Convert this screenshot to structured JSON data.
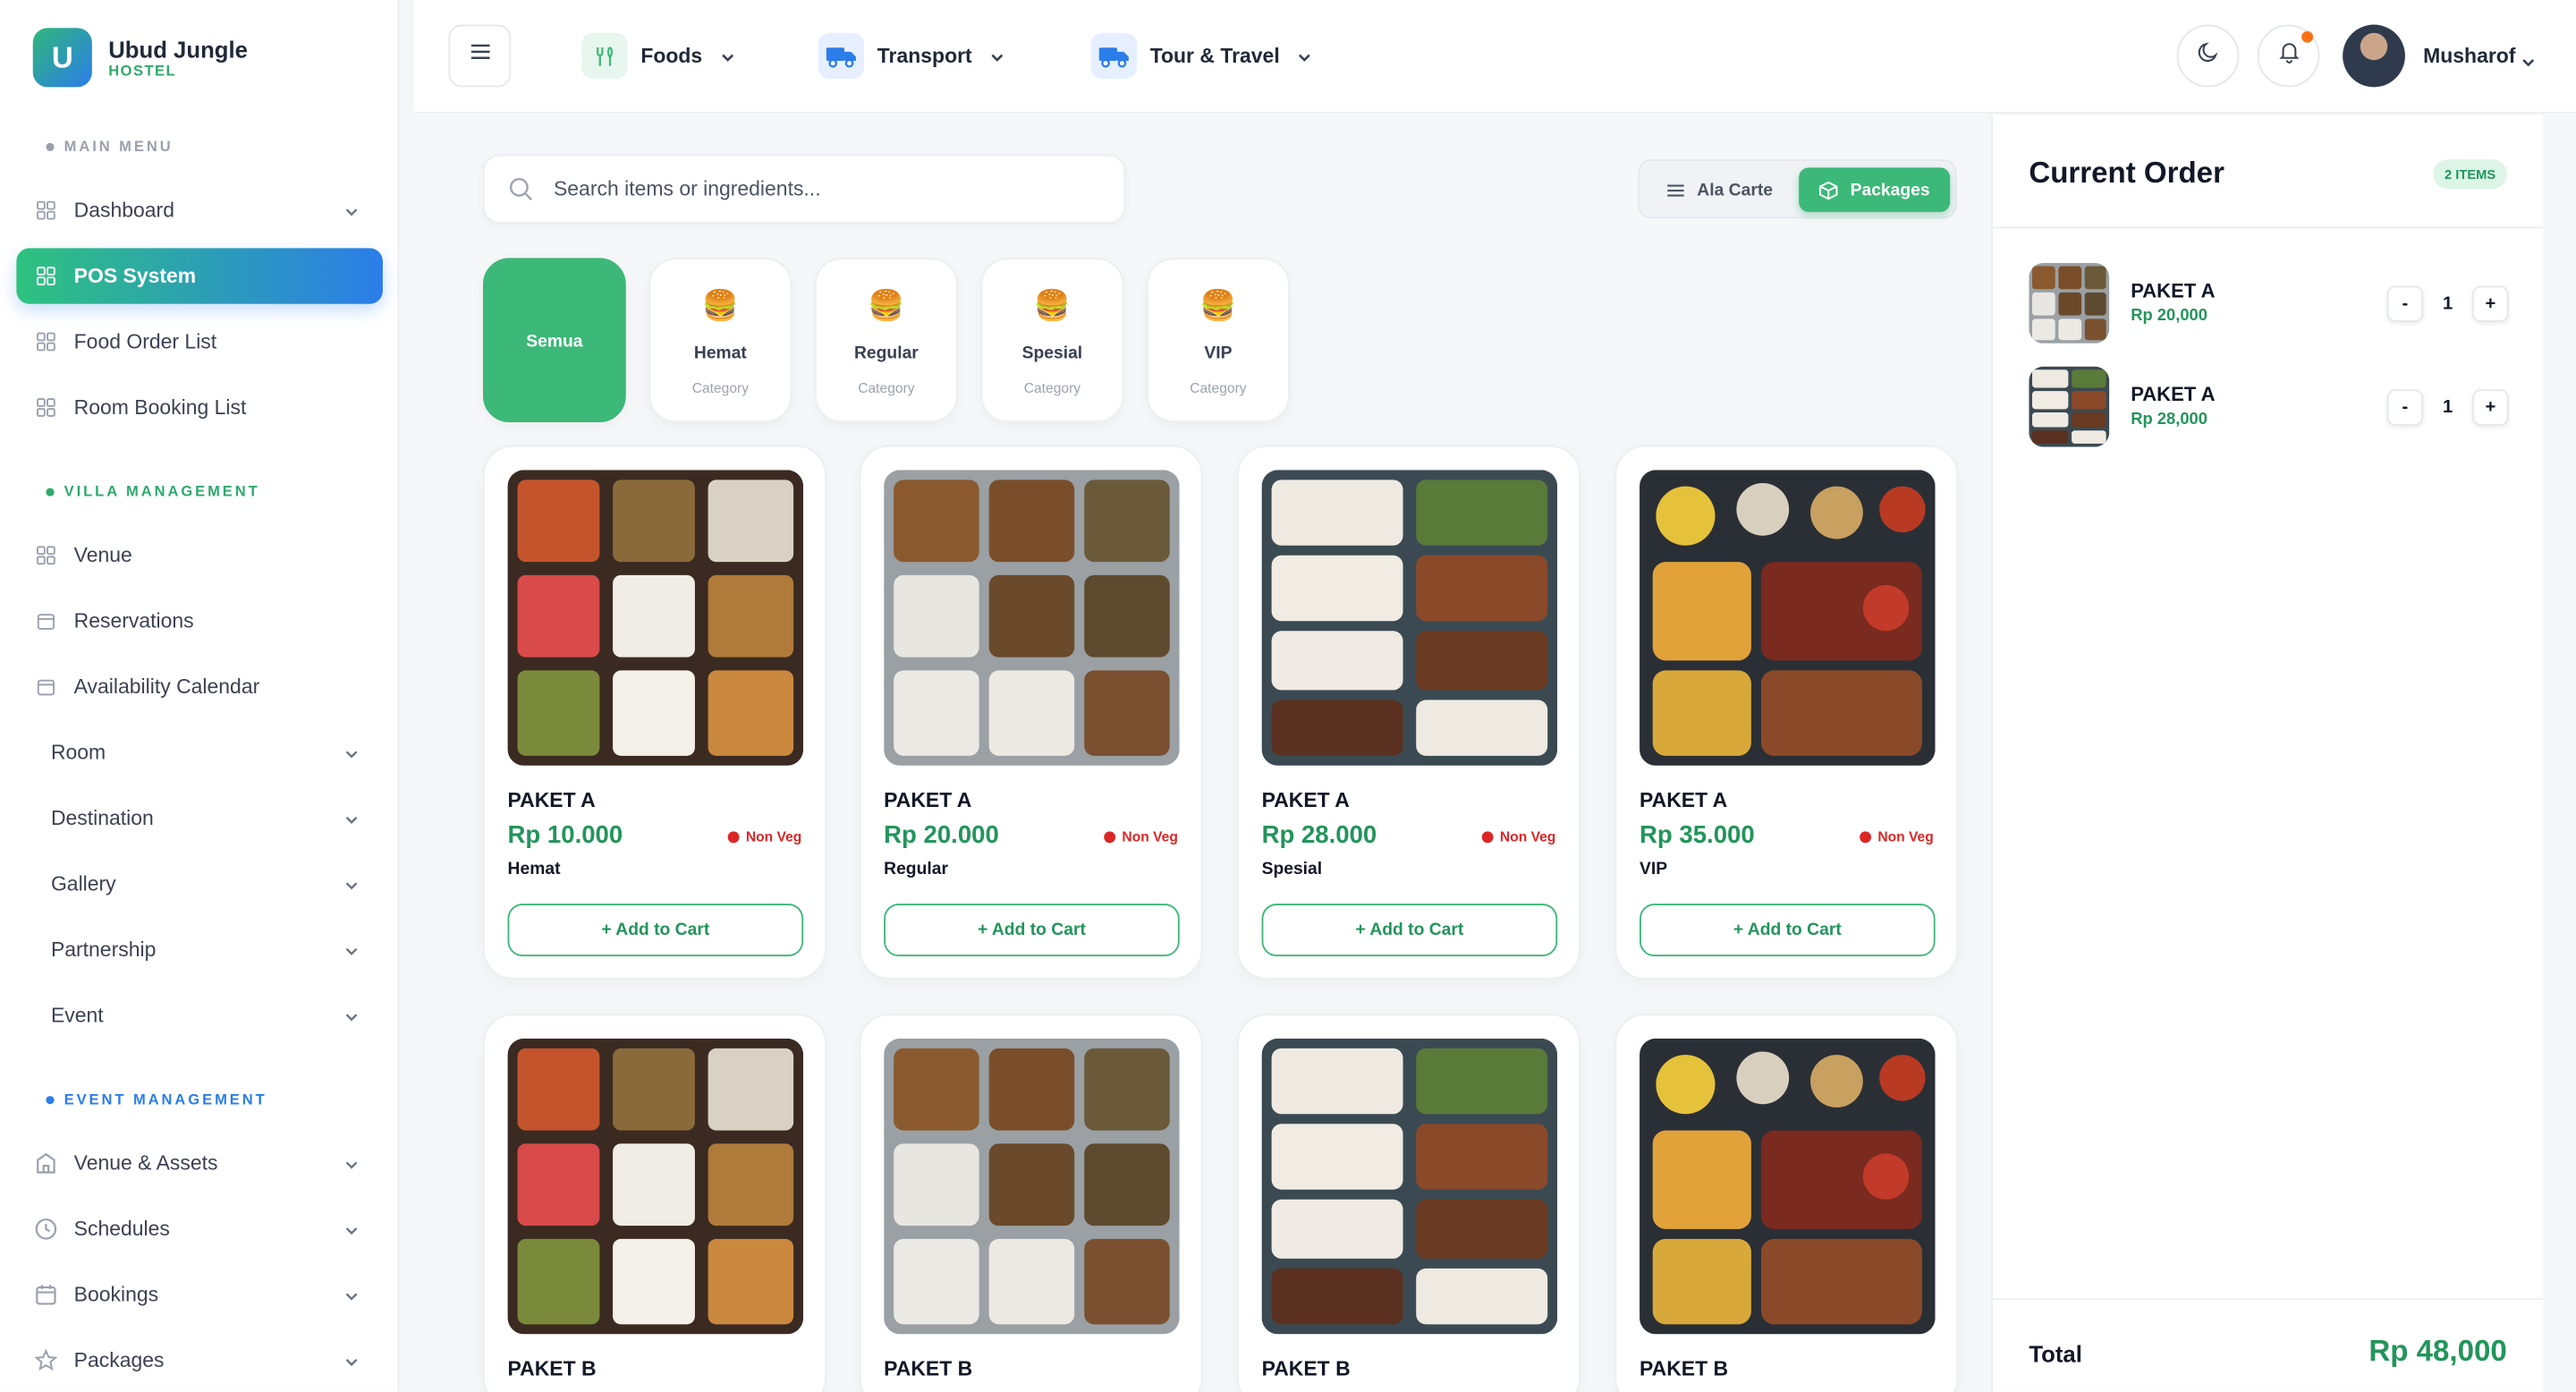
{
  "brand": {
    "initial": "U",
    "name": "Ubud Jungle",
    "sub": "HOSTEL"
  },
  "sidebar": {
    "sections": [
      {
        "label": "MAIN MENU",
        "color": "#9aa1ad"
      },
      {
        "label": "VILLA MANAGEMENT",
        "color": "#2fa86c"
      },
      {
        "label": "EVENT MANAGEMENT",
        "color": "#2b7de9"
      }
    ],
    "items": [
      {
        "label": "Dashboard",
        "icon": "grid-icon",
        "has_chevron": true,
        "active": false
      },
      {
        "label": "POS System",
        "icon": "grid-icon",
        "has_chevron": false,
        "active": true
      },
      {
        "label": "Food Order List",
        "icon": "grid-icon",
        "has_chevron": false,
        "active": false
      },
      {
        "label": "Room Booking List",
        "icon": "grid-icon",
        "has_chevron": false,
        "active": false
      },
      {
        "label": "Venue",
        "icon": "grid-icon",
        "has_chevron": false,
        "active": false
      },
      {
        "label": "Reservations",
        "icon": "calendar-icon",
        "has_chevron": false,
        "active": false
      },
      {
        "label": "Availability Calendar",
        "icon": "calendar-icon",
        "has_chevron": false,
        "active": false
      },
      {
        "label": "Room",
        "icon": "",
        "has_chevron": true,
        "active": false
      },
      {
        "label": "Destination",
        "icon": "",
        "has_chevron": true,
        "active": false
      },
      {
        "label": "Gallery",
        "icon": "",
        "has_chevron": true,
        "active": false
      },
      {
        "label": "Partnership",
        "icon": "",
        "has_chevron": true,
        "active": false
      },
      {
        "label": "Event",
        "icon": "",
        "has_chevron": true,
        "active": false
      },
      {
        "label": "Venue & Assets",
        "icon": "building-icon",
        "has_chevron": true,
        "active": false
      },
      {
        "label": "Schedules",
        "icon": "clock-icon",
        "has_chevron": true,
        "active": false
      },
      {
        "label": "Bookings",
        "icon": "calendar-icon",
        "has_chevron": true,
        "active": false
      },
      {
        "label": "Packages",
        "icon": "star-icon",
        "has_chevron": true,
        "active": false
      }
    ]
  },
  "topbar": {
    "nav": [
      {
        "label": "Foods",
        "icon": "fork-knife-icon"
      },
      {
        "label": "Transport",
        "icon": "truck-icon"
      },
      {
        "label": "Tour & Travel",
        "icon": "truck-icon"
      }
    ],
    "user_name": "Musharof"
  },
  "search": {
    "placeholder": "Search items or ingredients..."
  },
  "toggle": {
    "alacarte": "Ala Carte",
    "packages": "Packages",
    "selected": "Packages"
  },
  "categories": [
    {
      "name": "Semua",
      "sub": "",
      "active": true
    },
    {
      "name": "Hemat",
      "sub": "Category",
      "active": false
    },
    {
      "name": "Regular",
      "sub": "Category",
      "active": false
    },
    {
      "name": "Spesial",
      "sub": "Category",
      "active": false
    },
    {
      "name": "VIP",
      "sub": "Category",
      "active": false
    }
  ],
  "products": [
    {
      "name": "PAKET A",
      "price": "Rp 10.000",
      "tag": "Non Veg",
      "category": "Hemat",
      "button": "+ Add to Cart"
    },
    {
      "name": "PAKET A",
      "price": "Rp 20.000",
      "tag": "Non Veg",
      "category": "Regular",
      "button": "+ Add to Cart"
    },
    {
      "name": "PAKET A",
      "price": "Rp 28.000",
      "tag": "Non Veg",
      "category": "Spesial",
      "button": "+ Add to Cart"
    },
    {
      "name": "PAKET A",
      "price": "Rp 35.000",
      "tag": "Non Veg",
      "category": "VIP",
      "button": "+ Add to Cart"
    },
    {
      "name": "PAKET B",
      "price": "",
      "tag": "",
      "category": "",
      "button": ""
    },
    {
      "name": "PAKET B",
      "price": "",
      "tag": "",
      "category": "",
      "button": ""
    },
    {
      "name": "PAKET B",
      "price": "",
      "tag": "",
      "category": "",
      "button": ""
    },
    {
      "name": "PAKET B",
      "price": "",
      "tag": "",
      "category": "",
      "button": ""
    }
  ],
  "order": {
    "title": "Current Order",
    "badge": "2 ITEMS",
    "items": [
      {
        "name": "PAKET A",
        "price": "Rp 20,000",
        "qty": "1",
        "minus": "-",
        "plus": "+"
      },
      {
        "name": "PAKET A",
        "price": "Rp 28,000",
        "qty": "1",
        "minus": "-",
        "plus": "+"
      }
    ],
    "total_label": "Total",
    "total_value": "Rp 48,000"
  },
  "colors": {
    "accent_green": "#3cb878",
    "price_green": "#22955b",
    "accent_blue": "#2b7de9",
    "nonveg_red": "#dc2626"
  }
}
